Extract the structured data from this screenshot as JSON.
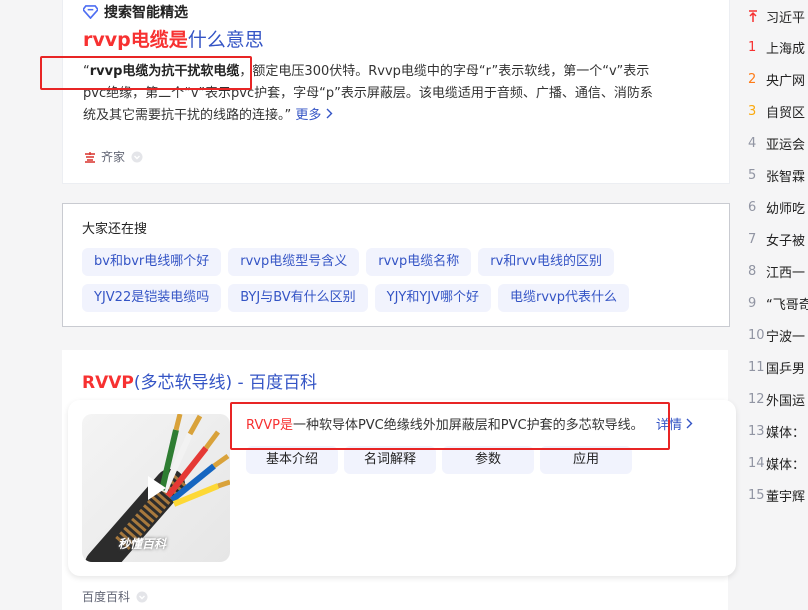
{
  "card1": {
    "label": "搜索智能精选",
    "title_em": "rvvp电缆是",
    "title_rest": "什么意思",
    "abstract_open": "“",
    "abstract_bold": "rvvp电缆为抗干扰软电缆",
    "abstract_text": "，额定电压300伏特。Rvvp电缆中的字母“r”表示软线，第一个“v”表示pvc绝缘，第二个“v”表示pvc护套，字母“p”表示屏蔽层。该电缆适用于音频、广播、通信、消防系统及其它需要抗干扰的线路的连接。”",
    "more": "更多",
    "source": "齐家"
  },
  "card2": {
    "title": "大家还在搜",
    "tags": [
      "bv和bvr电线哪个好",
      "rvvp电缆型号含义",
      "rvvp电缆名称",
      "rv和rvv电线的区别",
      "YJV22是铠装电缆吗",
      "BYJ与BV有什么区别",
      "YJY和YJV哪个好",
      "电缆rvvp代表什么"
    ]
  },
  "card3": {
    "title_em": "RVVP",
    "title_rest": "(多芯软导线) - 百度百科",
    "thumb_watermark": "秒懂百科",
    "def_em": "RVVP是",
    "def_rest": "一种软导体PVC绝缘线外加屏蔽层和PVC护套的多芯软导线。",
    "detail": "详情",
    "buttons": [
      "基本介绍",
      "名词解释",
      "参数",
      "应用"
    ],
    "source": "百度百科"
  },
  "sidebar": {
    "top_item": "习近平",
    "items": [
      {
        "num": "1",
        "text": "上海成"
      },
      {
        "num": "2",
        "text": "央广网"
      },
      {
        "num": "3",
        "text": "自贸区"
      },
      {
        "num": "4",
        "text": "亚运会"
      },
      {
        "num": "5",
        "text": "张智霖"
      },
      {
        "num": "6",
        "text": "幼师吃"
      },
      {
        "num": "7",
        "text": "女子被"
      },
      {
        "num": "8",
        "text": "江西一"
      },
      {
        "num": "9",
        "text": "“飞哥奇"
      },
      {
        "num": "10",
        "text": "宁波一"
      },
      {
        "num": "11",
        "text": "国乒男"
      },
      {
        "num": "12",
        "text": "外国运"
      },
      {
        "num": "13",
        "text": "媒体："
      },
      {
        "num": "14",
        "text": "媒体："
      },
      {
        "num": "15",
        "text": "董宇辉"
      }
    ]
  },
  "colors": {
    "link": "#3454c5",
    "highlight": "#f73131",
    "box": "#e82525",
    "rank1": "#f73131",
    "rank2": "#fe7b17",
    "rank3": "#faa90e"
  }
}
